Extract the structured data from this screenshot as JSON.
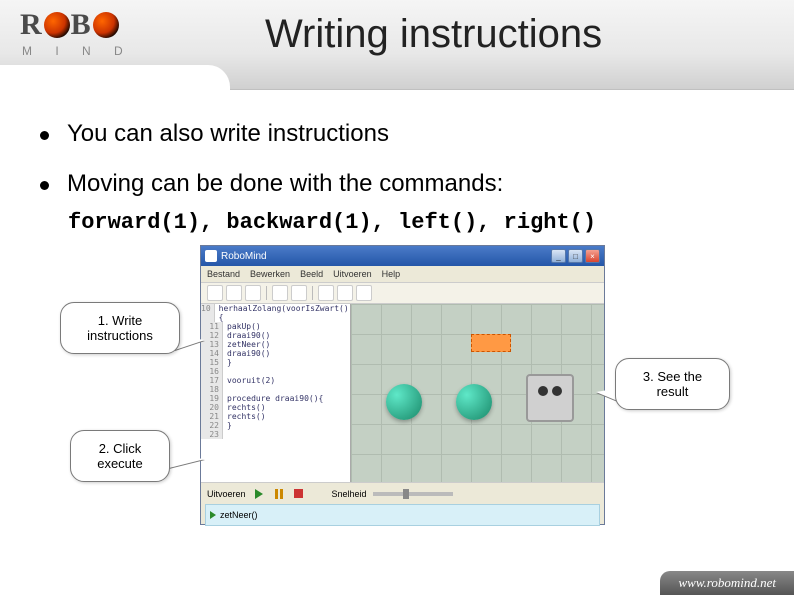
{
  "logo": {
    "main": "R",
    "mid": "B",
    "sub": "M I N D"
  },
  "title": "Writing instructions",
  "bullets": [
    "You can also write instructions",
    "Moving can be done with the commands:"
  ],
  "code_commands": "forward(1), backward(1), left(), right()",
  "app": {
    "title": "RoboMind",
    "menu": [
      "Bestand",
      "Bewerken",
      "Beeld",
      "Uitvoeren",
      "Help"
    ],
    "code_lines": [
      {
        "n": "10",
        "t": "herhaalZolang(voorIsZwart()){"
      },
      {
        "n": "11",
        "t": "  pakUp()"
      },
      {
        "n": "12",
        "t": "  draai90()"
      },
      {
        "n": "13",
        "t": "  zetNeer()"
      },
      {
        "n": "14",
        "t": "  draai90()"
      },
      {
        "n": "15",
        "t": "}"
      },
      {
        "n": "16",
        "t": ""
      },
      {
        "n": "17",
        "t": "vooruit(2)"
      },
      {
        "n": "18",
        "t": ""
      },
      {
        "n": "19",
        "t": "procedure draai90(){"
      },
      {
        "n": "20",
        "t": "  rechts()"
      },
      {
        "n": "21",
        "t": "  rechts()"
      },
      {
        "n": "22",
        "t": "}"
      },
      {
        "n": "23",
        "t": ""
      }
    ],
    "run_label": "Uitvoeren",
    "speed_label": "Snelheid",
    "status": "zetNeer()"
  },
  "callouts": {
    "c1": "1. Write instructions",
    "c2": "2. Click execute",
    "c3": "3. See the result"
  },
  "footer": "www.robomind.net"
}
